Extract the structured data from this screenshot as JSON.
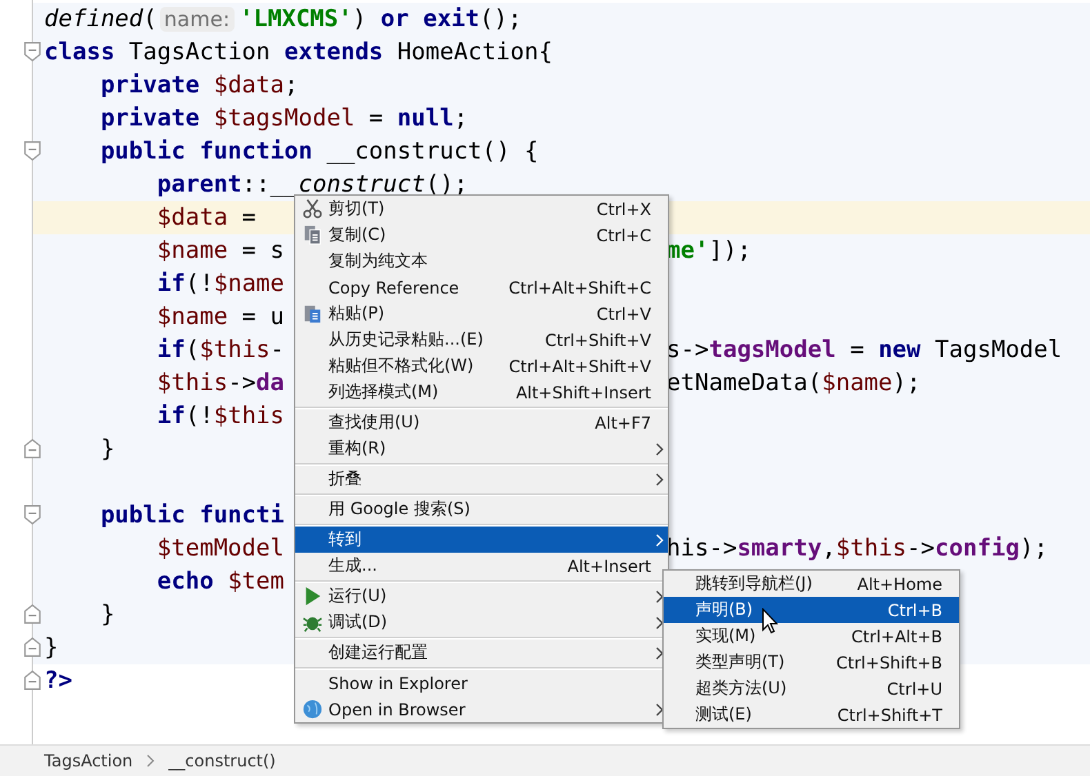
{
  "editor": {
    "lines": [
      {
        "current": false,
        "left": [
          {
            "text": "defined",
            "kind": "italic"
          },
          {
            "text": "(",
            "kind": "plain"
          },
          {
            "text": "name:",
            "kind": "hint"
          },
          {
            "text": "'LMXCMS'",
            "kind": "string"
          },
          {
            "text": ") ",
            "kind": "plain"
          },
          {
            "text": "or exit",
            "kind": "keyword"
          },
          {
            "text": "();",
            "kind": "plain"
          }
        ]
      },
      {
        "current": false,
        "fold": {
          "kind": "open"
        },
        "left": [
          {
            "text": "class ",
            "kind": "keyword"
          },
          {
            "text": "TagsAction ",
            "kind": "plain"
          },
          {
            "text": "extends ",
            "kind": "keyword"
          },
          {
            "text": "HomeAction{",
            "kind": "plain"
          }
        ]
      },
      {
        "current": false,
        "left": [
          {
            "text": "    private ",
            "kind": "keyword"
          },
          {
            "text": "$data",
            "kind": "var"
          },
          {
            "text": ";",
            "kind": "plain"
          }
        ]
      },
      {
        "current": false,
        "left": [
          {
            "text": "    private ",
            "kind": "keyword"
          },
          {
            "text": "$tagsModel",
            "kind": "var"
          },
          {
            "text": " = ",
            "kind": "plain"
          },
          {
            "text": "null",
            "kind": "keyword"
          },
          {
            "text": ";",
            "kind": "plain"
          }
        ]
      },
      {
        "current": false,
        "fold": {
          "kind": "open"
        },
        "left": [
          {
            "text": "    public function ",
            "kind": "keyword"
          },
          {
            "text": "__construct() {",
            "kind": "plain"
          }
        ]
      },
      {
        "current": false,
        "left": [
          {
            "text": "        parent",
            "kind": "keyword"
          },
          {
            "text": "::",
            "kind": "plain"
          },
          {
            "text": "__construct",
            "kind": "italic"
          },
          {
            "text": "();",
            "kind": "plain"
          }
        ]
      },
      {
        "current": true,
        "left": [
          {
            "text": "        $data",
            "kind": "var"
          },
          {
            "text": " =",
            "kind": "plain"
          }
        ]
      },
      {
        "current": false,
        "left": [
          {
            "text": "        $name",
            "kind": "var"
          },
          {
            "text": " = s",
            "kind": "plain"
          }
        ],
        "right": [
          {
            "text": "me'",
            "kind": "string"
          },
          {
            "text": "]);",
            "kind": "plain"
          }
        ]
      },
      {
        "current": false,
        "left": [
          {
            "text": "        if",
            "kind": "keyword"
          },
          {
            "text": "(!",
            "kind": "plain"
          },
          {
            "text": "$name",
            "kind": "var"
          }
        ]
      },
      {
        "current": false,
        "left": [
          {
            "text": "        $name",
            "kind": "var"
          },
          {
            "text": " = u",
            "kind": "plain"
          }
        ]
      },
      {
        "current": false,
        "left": [
          {
            "text": "        if",
            "kind": "keyword"
          },
          {
            "text": "(",
            "kind": "plain"
          },
          {
            "text": "$this",
            "kind": "var"
          },
          {
            "text": "-",
            "kind": "plain"
          }
        ],
        "right": [
          {
            "text": "s->",
            "kind": "plain"
          },
          {
            "text": "tagsModel",
            "kind": "field"
          },
          {
            "text": " = ",
            "kind": "plain"
          },
          {
            "text": "new ",
            "kind": "keyword"
          },
          {
            "text": "TagsModel",
            "kind": "plain"
          }
        ]
      },
      {
        "current": false,
        "left": [
          {
            "text": "        $this",
            "kind": "var"
          },
          {
            "text": "->",
            "kind": "plain"
          },
          {
            "text": "da",
            "kind": "field"
          }
        ],
        "right": [
          {
            "text": "etNameData(",
            "kind": "plain"
          },
          {
            "text": "$name",
            "kind": "var"
          },
          {
            "text": ");",
            "kind": "plain"
          }
        ]
      },
      {
        "current": false,
        "left": [
          {
            "text": "        if",
            "kind": "keyword"
          },
          {
            "text": "(!",
            "kind": "plain"
          },
          {
            "text": "$this",
            "kind": "var"
          }
        ]
      },
      {
        "current": false,
        "fold": {
          "kind": "close"
        },
        "left": [
          {
            "text": "    }",
            "kind": "plain"
          }
        ]
      },
      {
        "current": false
      },
      {
        "current": false,
        "fold": {
          "kind": "open"
        },
        "left": [
          {
            "text": "    public functi",
            "kind": "keyword"
          }
        ]
      },
      {
        "current": false,
        "left": [
          {
            "text": "        $temModel",
            "kind": "var"
          }
        ],
        "right": [
          {
            "text": "his->",
            "kind": "plain"
          },
          {
            "text": "smarty",
            "kind": "field"
          },
          {
            "text": ",",
            "kind": "plain"
          },
          {
            "text": "$this",
            "kind": "var"
          },
          {
            "text": "->",
            "kind": "plain"
          },
          {
            "text": "config",
            "kind": "field"
          },
          {
            "text": ");",
            "kind": "plain"
          }
        ]
      },
      {
        "current": false,
        "left": [
          {
            "text": "        echo ",
            "kind": "keyword"
          },
          {
            "text": "$tem",
            "kind": "var"
          }
        ]
      },
      {
        "current": false,
        "fold": {
          "kind": "close"
        },
        "left": [
          {
            "text": "    }",
            "kind": "plain"
          }
        ]
      },
      {
        "current": false,
        "fold": {
          "kind": "close"
        },
        "left": [
          {
            "text": "}",
            "kind": "plain"
          }
        ]
      },
      {
        "current": false,
        "fold": {
          "kind": "close"
        },
        "left": [
          {
            "text": "?>",
            "kind": "keyword"
          }
        ]
      }
    ]
  },
  "context_menu": {
    "groups": [
      [
        {
          "kind": "cut",
          "label": "剪切(T)",
          "shortcut": "Ctrl+X",
          "submenu": false,
          "selected": false
        },
        {
          "kind": "copy",
          "label": "复制(C)",
          "shortcut": "Ctrl+C",
          "submenu": false,
          "selected": false
        },
        {
          "kind": "command",
          "label": "复制为纯文本",
          "submenu": false,
          "selected": false
        },
        {
          "kind": "command",
          "label": "Copy Reference",
          "shortcut": "Ctrl+Alt+Shift+C",
          "submenu": false,
          "selected": false
        },
        {
          "kind": "paste",
          "label": "粘贴(P)",
          "shortcut": "Ctrl+V",
          "submenu": false,
          "selected": false
        },
        {
          "kind": "command",
          "label": "从历史记录粘贴...(E)",
          "shortcut": "Ctrl+Shift+V",
          "submenu": false,
          "selected": false
        },
        {
          "kind": "command",
          "label": "粘贴但不格式化(W)",
          "shortcut": "Ctrl+Alt+Shift+V",
          "submenu": false,
          "selected": false
        },
        {
          "kind": "command",
          "label": "列选择模式(M)",
          "shortcut": "Alt+Shift+Insert",
          "submenu": false,
          "selected": false
        }
      ],
      [
        {
          "kind": "command",
          "label": "查找使用(U)",
          "shortcut": "Alt+F7",
          "submenu": false,
          "selected": false
        },
        {
          "kind": "command",
          "label": "重构(R)",
          "submenu": true,
          "selected": false
        }
      ],
      [
        {
          "kind": "command",
          "label": "折叠",
          "submenu": true,
          "selected": false
        }
      ],
      [
        {
          "kind": "command",
          "label": "用 Google 搜索(S)",
          "submenu": false,
          "selected": false
        }
      ],
      [
        {
          "kind": "command",
          "label": "转到",
          "submenu": true,
          "selected": true
        },
        {
          "kind": "command",
          "label": "生成...",
          "shortcut": "Alt+Insert",
          "submenu": false,
          "selected": false
        }
      ],
      [
        {
          "kind": "run",
          "label": "运行(U)",
          "submenu": true,
          "selected": false
        },
        {
          "kind": "debug",
          "label": "调试(D)",
          "submenu": true,
          "selected": false
        }
      ],
      [
        {
          "kind": "command",
          "label": "创建运行配置",
          "submenu": true,
          "selected": false
        }
      ],
      [
        {
          "kind": "command",
          "label": "Show in Explorer",
          "submenu": false,
          "selected": false
        },
        {
          "kind": "browser",
          "label": "Open in Browser",
          "submenu": true,
          "selected": false
        }
      ]
    ]
  },
  "submenu": {
    "items": [
      {
        "label": "跳转到导航栏(J)",
        "shortcut": "Alt+Home",
        "selected": false
      },
      {
        "label": "声明(B)",
        "shortcut": "Ctrl+B",
        "selected": true
      },
      {
        "label": "实现(M)",
        "shortcut": "Ctrl+Alt+B",
        "selected": false
      },
      {
        "label": "类型声明(T)",
        "shortcut": "Ctrl+Shift+B",
        "selected": false
      },
      {
        "label": "超类方法(U)",
        "shortcut": "Ctrl+U",
        "selected": false
      },
      {
        "label": "测试(E)",
        "shortcut": "Ctrl+Shift+T",
        "selected": false
      }
    ]
  },
  "breadcrumb": [
    "TagsAction",
    "__construct()"
  ]
}
